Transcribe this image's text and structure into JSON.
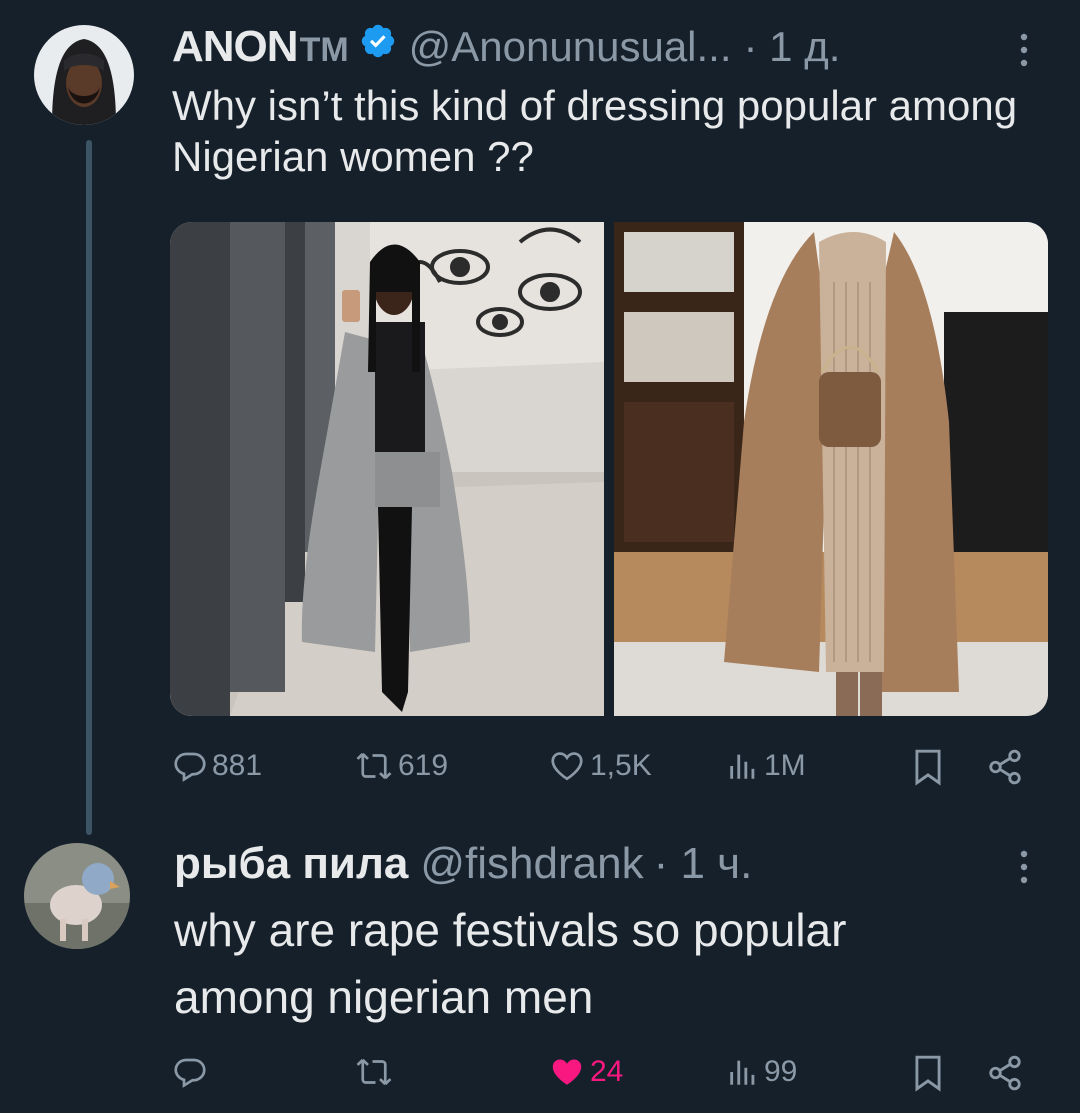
{
  "post": {
    "display_name": "ANON",
    "name_suffix": "TM",
    "handle": "@Anonunusual...",
    "time": "· 1 д.",
    "text": "Why isn’t this kind of dressing popular among Nigerian women ??",
    "stats": {
      "replies": "881",
      "reposts": "619",
      "likes": "1,5K",
      "views": "1M"
    },
    "verified_color": "#1d9bf0"
  },
  "reply": {
    "display_name": "рыба пила",
    "handle": "@fishdrank",
    "time": "· 1 ч.",
    "text": "why are rape festivals so popular among nigerian men",
    "stats": {
      "replies": "",
      "reposts": "",
      "likes": "24",
      "views": "99"
    },
    "liked": true,
    "like_color": "#f91880"
  },
  "colors": {
    "background": "#15202b",
    "text": "#e7e9ea",
    "muted": "#8b98a5"
  }
}
